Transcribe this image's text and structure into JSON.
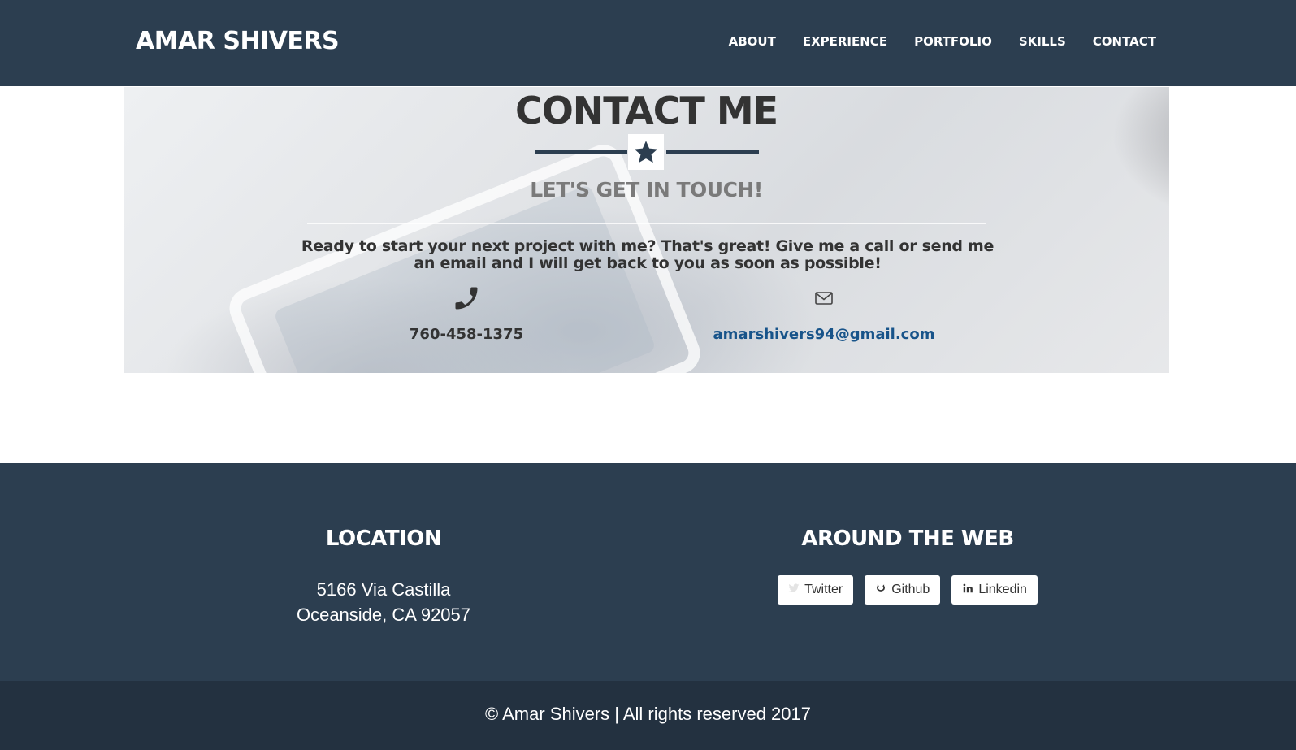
{
  "navbar": {
    "brand": "AMAR SHIVERS",
    "links": [
      "ABOUT",
      "EXPERIENCE",
      "PORTFOLIO",
      "SKILLS",
      "CONTACT"
    ]
  },
  "contact": {
    "title": "CONTACT ME",
    "divider_icon": "star-icon",
    "subtitle": "LET'S GET IN TOUCH!",
    "blurb": "Ready to start your next project with me? That's great! Give me a call or send me an email and I will get back to you as soon as possible!",
    "phone": {
      "icon": "phone-icon",
      "value": "760-458-1375"
    },
    "email": {
      "icon": "envelope-icon",
      "value": "amarshivers94@gmail.com"
    }
  },
  "footer": {
    "location": {
      "heading": "LOCATION",
      "line1": "5166 Via Castilla",
      "line2": "Oceanside, CA 92057"
    },
    "web": {
      "heading": "AROUND THE WEB",
      "buttons": [
        {
          "icon": "twitter-icon",
          "label": "Twitter"
        },
        {
          "icon": "github-icon",
          "label": "Github"
        },
        {
          "icon": "linkedin-icon",
          "label": "Linkedin"
        }
      ]
    },
    "copyright": "© Amar Shivers | All rights reserved 2017"
  },
  "colors": {
    "navy": "#2c3e50",
    "dark_navy": "#233140",
    "link_blue": "#18548a",
    "text_dark": "#333333",
    "subtitle_gray": "#7a7a7a"
  }
}
